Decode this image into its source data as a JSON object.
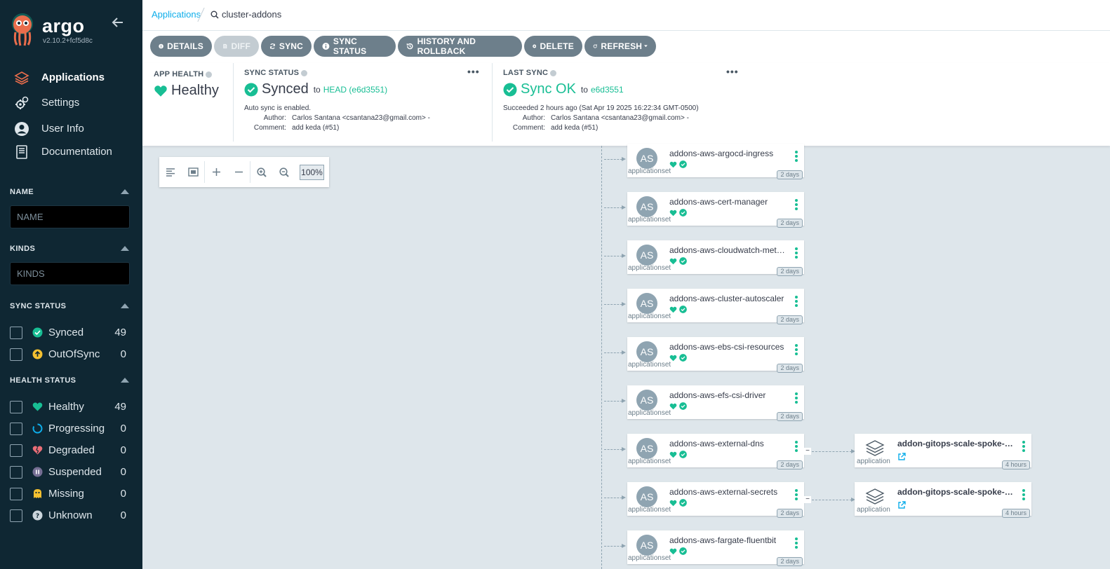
{
  "brand": {
    "name": "argo",
    "version": "v2.10.2+fcf5d8c"
  },
  "nav": [
    {
      "label": "Applications",
      "icon": "layers-icon",
      "active": true
    },
    {
      "label": "Settings",
      "icon": "gears-icon"
    },
    {
      "label": "User Info",
      "icon": "user-circle-icon"
    },
    {
      "label": "Documentation",
      "icon": "book-icon"
    }
  ],
  "filters": {
    "name": {
      "title": "NAME",
      "placeholder": "NAME"
    },
    "kinds": {
      "title": "KINDS",
      "placeholder": "KINDS"
    },
    "sync_status": {
      "title": "SYNC STATUS",
      "items": [
        {
          "label": "Synced",
          "count": "49",
          "color": "#18be94"
        },
        {
          "label": "OutOfSync",
          "count": "0",
          "color": "#f4c030"
        }
      ]
    },
    "health_status": {
      "title": "HEALTH STATUS",
      "items": [
        {
          "label": "Healthy",
          "count": "49",
          "color": "#18be94"
        },
        {
          "label": "Progressing",
          "count": "0",
          "color": "#0dadea"
        },
        {
          "label": "Degraded",
          "count": "0",
          "color": "#e96d76"
        },
        {
          "label": "Suspended",
          "count": "0",
          "color": "#766f94"
        },
        {
          "label": "Missing",
          "count": "0",
          "color": "#f4c030"
        },
        {
          "label": "Unknown",
          "count": "0",
          "color": "#ccd6dd"
        }
      ]
    }
  },
  "breadcrumb": {
    "root": "Applications",
    "current": "cluster-addons"
  },
  "toolbar": {
    "details": "DETAILS",
    "diff": "DIFF",
    "sync": "SYNC",
    "sync_status": "SYNC STATUS",
    "history": "HISTORY AND ROLLBACK",
    "delete": "DELETE",
    "refresh": "REFRESH"
  },
  "app_health": {
    "label": "APP HEALTH",
    "value": "Healthy"
  },
  "sync_status": {
    "label": "SYNC STATUS",
    "value": "Synced",
    "to": "to",
    "revision": "HEAD (e6d3551)",
    "auto": "Auto sync is enabled.",
    "author_key": "Author:",
    "author": "Carlos Santana <csantana23@gmail.com> -",
    "comment_key": "Comment:",
    "comment": "add keda (#51)"
  },
  "last_sync": {
    "label": "LAST SYNC",
    "value": "Sync OK",
    "to": "to",
    "revision": "e6d3551",
    "succeeded": "Succeeded 2 hours ago (Sat Apr 19 2025 16:22:34 GMT-0500)",
    "author_key": "Author:",
    "author": "Carlos Santana <csantana23@gmail.com> -",
    "comment_key": "Comment:",
    "comment": "add keda (#51)"
  },
  "zoom": {
    "value": "100%"
  },
  "nodes": [
    {
      "title": "addons-aws-argocd-ingress",
      "kind": "applicationset",
      "age": "2 days",
      "avatar": "AS"
    },
    {
      "title": "addons-aws-cert-manager",
      "kind": "applicationset",
      "age": "2 days",
      "avatar": "AS"
    },
    {
      "title": "addons-aws-cloudwatch-metr...",
      "kind": "applicationset",
      "age": "2 days",
      "avatar": "AS"
    },
    {
      "title": "addons-aws-cluster-autoscaler",
      "kind": "applicationset",
      "age": "2 days",
      "avatar": "AS"
    },
    {
      "title": "addons-aws-ebs-csi-resources",
      "kind": "applicationset",
      "age": "2 days",
      "avatar": "AS"
    },
    {
      "title": "addons-aws-efs-csi-driver",
      "kind": "applicationset",
      "age": "2 days",
      "avatar": "AS"
    },
    {
      "title": "addons-aws-external-dns",
      "kind": "applicationset",
      "age": "2 days",
      "avatar": "AS"
    },
    {
      "title": "addons-aws-external-secrets",
      "kind": "applicationset",
      "age": "2 days",
      "avatar": "AS"
    },
    {
      "title": "addons-aws-fargate-fluentbit",
      "kind": "applicationset",
      "age": "2 days",
      "avatar": "AS"
    }
  ],
  "child_nodes": [
    {
      "title": "addon-gitops-scale-spoke-de...",
      "kind": "application",
      "age": "4 hours"
    },
    {
      "title": "addon-gitops-scale-spoke-de...",
      "kind": "application",
      "age": "4 hours"
    }
  ]
}
